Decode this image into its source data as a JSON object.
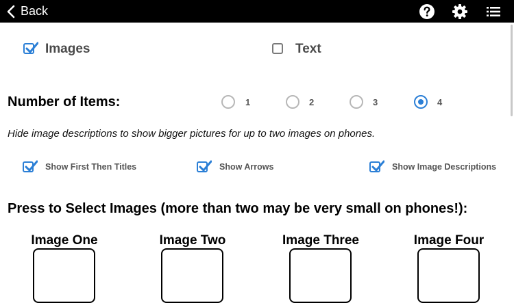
{
  "header": {
    "back_label": "Back",
    "help_icon": "question-circle-icon",
    "settings_icon": "gear-icon",
    "menu_icon": "list-icon"
  },
  "content_type": {
    "images": {
      "label": "Images",
      "checked": true
    },
    "text": {
      "label": "Text",
      "checked": false
    }
  },
  "number_of_items": {
    "title": "Number of Items:",
    "options": [
      "1",
      "2",
      "3",
      "4"
    ],
    "selected": "4"
  },
  "hint": "Hide image descriptions to show bigger pictures for up to two images on phones.",
  "options": [
    {
      "label": "Show First Then Titles",
      "checked": true
    },
    {
      "label": "Show Arrows",
      "checked": true
    },
    {
      "label": "Show Image Descriptions",
      "checked": true
    }
  ],
  "select_images": {
    "title": "Press to Select Images (more than two may be very small on phones!):",
    "slots": [
      "Image One",
      "Image Two",
      "Image Three",
      "Image Four"
    ]
  },
  "colors": {
    "accent": "#2b7fd6",
    "topbar": "#000000"
  }
}
